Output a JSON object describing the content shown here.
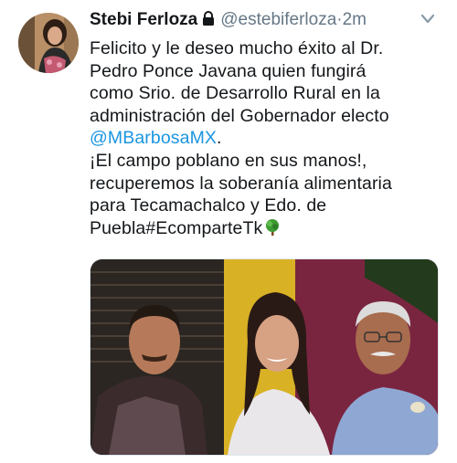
{
  "tweet": {
    "author_name": "Stebi Ferloza",
    "author_handle": "@estebiferloza",
    "separator": "·",
    "time": "2m",
    "lines": [
      "Felicito y le deseo mucho éxito al Dr.",
      "Pedro Ponce Javana quien fungirá",
      "como Srio. de Desarrollo Rural en la",
      "administración del Gobernador electo"
    ],
    "mention": "@MBarbosaMX",
    "mention_suffix": ".",
    "lines2": [
      "¡El campo poblano en sus manos!,",
      "recuperemos la soberanía alimentaria",
      "para Tecamachalco y Edo. de",
      "Puebla#EcomparteTk"
    ]
  },
  "icons": {
    "lock": "lock-icon",
    "chevron": "chevron-down-icon",
    "tree": "tree-emoji-icon"
  },
  "colors": {
    "text": "#14171a",
    "secondary": "#657786",
    "link": "#1b95e0"
  }
}
